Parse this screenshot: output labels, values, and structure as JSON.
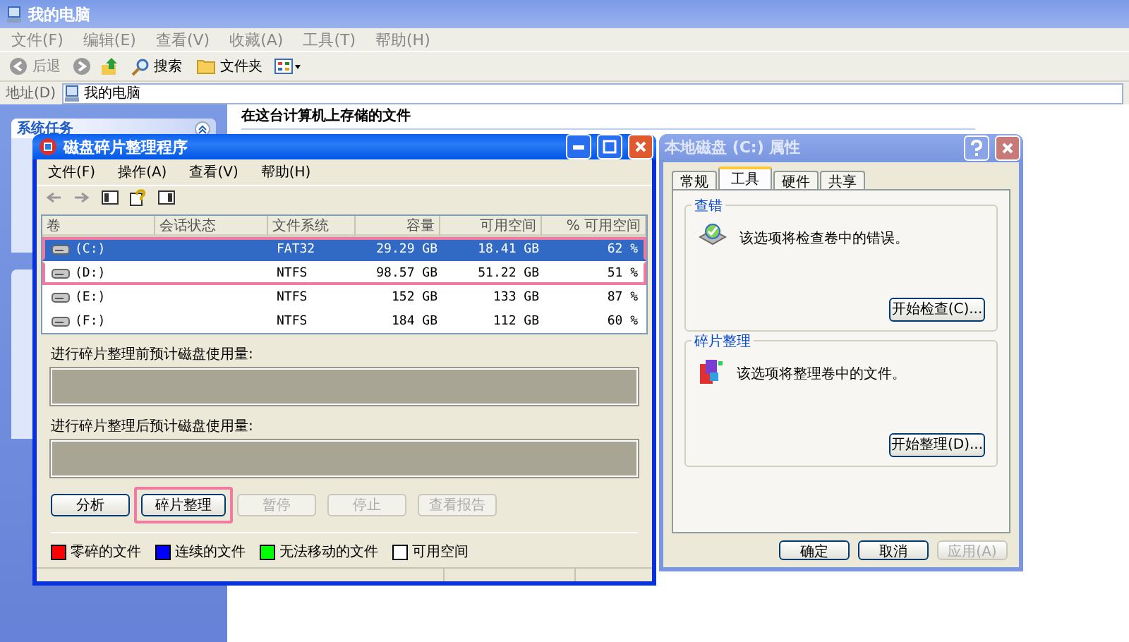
{
  "explorer": {
    "title": "我的电脑",
    "menu": [
      "文件(F)",
      "编辑(E)",
      "查看(V)",
      "收藏(A)",
      "工具(T)",
      "帮助(H)"
    ],
    "toolbar": [
      {
        "kind": "back",
        "label": "后退"
      },
      {
        "kind": "forward"
      },
      {
        "kind": "up"
      },
      {
        "kind": "search",
        "label": "搜索"
      },
      {
        "kind": "folders",
        "label": "文件夹"
      },
      {
        "kind": "views"
      }
    ],
    "address_label": "地址(D)",
    "address": "我的电脑",
    "sidebar_panels": [
      {
        "title": "系统任务"
      }
    ],
    "heading": "在这台计算机上存储的文件"
  },
  "defrag": {
    "title": "磁盘碎片整理程序",
    "active": true,
    "menu": [
      "文件(F)",
      "操作(A)",
      "查看(V)",
      "帮助(H)"
    ],
    "table": {
      "columns": [
        "卷",
        "会话状态",
        "文件系统",
        "容量",
        "可用空间",
        "% 可用空间"
      ],
      "rows": [
        {
          "cells": [
            "(C:)",
            "",
            "FAT32",
            "29.29 GB",
            "18.41 GB",
            "62 %"
          ],
          "selected": true,
          "highlighted": true
        },
        {
          "cells": [
            "(D:)",
            "",
            "NTFS",
            "98.57 GB",
            "51.22 GB",
            "51 %"
          ],
          "selected": false,
          "highlighted": true
        },
        {
          "cells": [
            "(E:)",
            "",
            "NTFS",
            "152 GB",
            "133 GB",
            "87 %"
          ],
          "selected": false,
          "highlighted": false
        },
        {
          "cells": [
            "(F:)",
            "",
            "NTFS",
            "184 GB",
            "112 GB",
            "60 %"
          ],
          "selected": false,
          "highlighted": false
        }
      ]
    },
    "before_label": "进行碎片整理前预计磁盘使用量:",
    "after_label": "进行碎片整理后预计磁盘使用量:",
    "buttons": [
      {
        "label": "分析",
        "disabled": false,
        "highlighted": false
      },
      {
        "label": "碎片整理",
        "disabled": false,
        "highlighted": true
      },
      {
        "label": "暂停",
        "disabled": true,
        "highlighted": false
      },
      {
        "label": "停止",
        "disabled": true,
        "highlighted": false
      },
      {
        "label": "查看报告",
        "disabled": true,
        "highlighted": false
      }
    ],
    "legend": [
      {
        "label": "零碎的文件",
        "color": "#ff0000"
      },
      {
        "label": "连续的文件",
        "color": "#0000ff"
      },
      {
        "label": "无法移动的文件",
        "color": "#00ff00"
      },
      {
        "label": "可用空间",
        "color": "#ffffff"
      }
    ]
  },
  "properties": {
    "title": "本地磁盘 (C:) 属性",
    "active": false,
    "tabs": [
      {
        "label": "常规",
        "selected": false
      },
      {
        "label": "工具",
        "selected": true
      },
      {
        "label": "硬件",
        "selected": false
      },
      {
        "label": "共享",
        "selected": false
      }
    ],
    "groups": [
      {
        "kind": "check",
        "title": "查错",
        "text": "该选项将检查卷中的错误。",
        "button": "开始检查(C)..."
      },
      {
        "kind": "defrag",
        "title": "碎片整理",
        "text": "该选项将整理卷中的文件。",
        "button": "开始整理(D)..."
      }
    ],
    "buttons": [
      {
        "label": "确定",
        "disabled": false
      },
      {
        "label": "取消",
        "disabled": false
      },
      {
        "label": "应用(A)",
        "disabled": true
      }
    ]
  }
}
